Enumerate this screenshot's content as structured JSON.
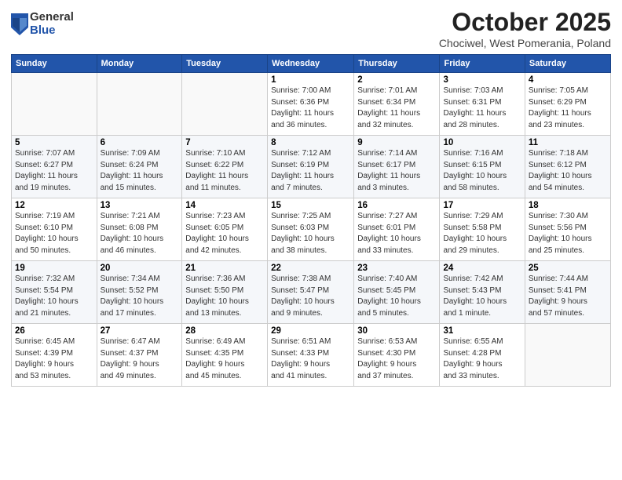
{
  "header": {
    "logo_general": "General",
    "logo_blue": "Blue",
    "month_title": "October 2025",
    "location": "Chociwel, West Pomerania, Poland"
  },
  "weekdays": [
    "Sunday",
    "Monday",
    "Tuesday",
    "Wednesday",
    "Thursday",
    "Friday",
    "Saturday"
  ],
  "weeks": [
    [
      {
        "day": "",
        "info": ""
      },
      {
        "day": "",
        "info": ""
      },
      {
        "day": "",
        "info": ""
      },
      {
        "day": "1",
        "info": "Sunrise: 7:00 AM\nSunset: 6:36 PM\nDaylight: 11 hours\nand 36 minutes."
      },
      {
        "day": "2",
        "info": "Sunrise: 7:01 AM\nSunset: 6:34 PM\nDaylight: 11 hours\nand 32 minutes."
      },
      {
        "day": "3",
        "info": "Sunrise: 7:03 AM\nSunset: 6:31 PM\nDaylight: 11 hours\nand 28 minutes."
      },
      {
        "day": "4",
        "info": "Sunrise: 7:05 AM\nSunset: 6:29 PM\nDaylight: 11 hours\nand 23 minutes."
      }
    ],
    [
      {
        "day": "5",
        "info": "Sunrise: 7:07 AM\nSunset: 6:27 PM\nDaylight: 11 hours\nand 19 minutes."
      },
      {
        "day": "6",
        "info": "Sunrise: 7:09 AM\nSunset: 6:24 PM\nDaylight: 11 hours\nand 15 minutes."
      },
      {
        "day": "7",
        "info": "Sunrise: 7:10 AM\nSunset: 6:22 PM\nDaylight: 11 hours\nand 11 minutes."
      },
      {
        "day": "8",
        "info": "Sunrise: 7:12 AM\nSunset: 6:19 PM\nDaylight: 11 hours\nand 7 minutes."
      },
      {
        "day": "9",
        "info": "Sunrise: 7:14 AM\nSunset: 6:17 PM\nDaylight: 11 hours\nand 3 minutes."
      },
      {
        "day": "10",
        "info": "Sunrise: 7:16 AM\nSunset: 6:15 PM\nDaylight: 10 hours\nand 58 minutes."
      },
      {
        "day": "11",
        "info": "Sunrise: 7:18 AM\nSunset: 6:12 PM\nDaylight: 10 hours\nand 54 minutes."
      }
    ],
    [
      {
        "day": "12",
        "info": "Sunrise: 7:19 AM\nSunset: 6:10 PM\nDaylight: 10 hours\nand 50 minutes."
      },
      {
        "day": "13",
        "info": "Sunrise: 7:21 AM\nSunset: 6:08 PM\nDaylight: 10 hours\nand 46 minutes."
      },
      {
        "day": "14",
        "info": "Sunrise: 7:23 AM\nSunset: 6:05 PM\nDaylight: 10 hours\nand 42 minutes."
      },
      {
        "day": "15",
        "info": "Sunrise: 7:25 AM\nSunset: 6:03 PM\nDaylight: 10 hours\nand 38 minutes."
      },
      {
        "day": "16",
        "info": "Sunrise: 7:27 AM\nSunset: 6:01 PM\nDaylight: 10 hours\nand 33 minutes."
      },
      {
        "day": "17",
        "info": "Sunrise: 7:29 AM\nSunset: 5:58 PM\nDaylight: 10 hours\nand 29 minutes."
      },
      {
        "day": "18",
        "info": "Sunrise: 7:30 AM\nSunset: 5:56 PM\nDaylight: 10 hours\nand 25 minutes."
      }
    ],
    [
      {
        "day": "19",
        "info": "Sunrise: 7:32 AM\nSunset: 5:54 PM\nDaylight: 10 hours\nand 21 minutes."
      },
      {
        "day": "20",
        "info": "Sunrise: 7:34 AM\nSunset: 5:52 PM\nDaylight: 10 hours\nand 17 minutes."
      },
      {
        "day": "21",
        "info": "Sunrise: 7:36 AM\nSunset: 5:50 PM\nDaylight: 10 hours\nand 13 minutes."
      },
      {
        "day": "22",
        "info": "Sunrise: 7:38 AM\nSunset: 5:47 PM\nDaylight: 10 hours\nand 9 minutes."
      },
      {
        "day": "23",
        "info": "Sunrise: 7:40 AM\nSunset: 5:45 PM\nDaylight: 10 hours\nand 5 minutes."
      },
      {
        "day": "24",
        "info": "Sunrise: 7:42 AM\nSunset: 5:43 PM\nDaylight: 10 hours\nand 1 minute."
      },
      {
        "day": "25",
        "info": "Sunrise: 7:44 AM\nSunset: 5:41 PM\nDaylight: 9 hours\nand 57 minutes."
      }
    ],
    [
      {
        "day": "26",
        "info": "Sunrise: 6:45 AM\nSunset: 4:39 PM\nDaylight: 9 hours\nand 53 minutes."
      },
      {
        "day": "27",
        "info": "Sunrise: 6:47 AM\nSunset: 4:37 PM\nDaylight: 9 hours\nand 49 minutes."
      },
      {
        "day": "28",
        "info": "Sunrise: 6:49 AM\nSunset: 4:35 PM\nDaylight: 9 hours\nand 45 minutes."
      },
      {
        "day": "29",
        "info": "Sunrise: 6:51 AM\nSunset: 4:33 PM\nDaylight: 9 hours\nand 41 minutes."
      },
      {
        "day": "30",
        "info": "Sunrise: 6:53 AM\nSunset: 4:30 PM\nDaylight: 9 hours\nand 37 minutes."
      },
      {
        "day": "31",
        "info": "Sunrise: 6:55 AM\nSunset: 4:28 PM\nDaylight: 9 hours\nand 33 minutes."
      },
      {
        "day": "",
        "info": ""
      }
    ]
  ]
}
